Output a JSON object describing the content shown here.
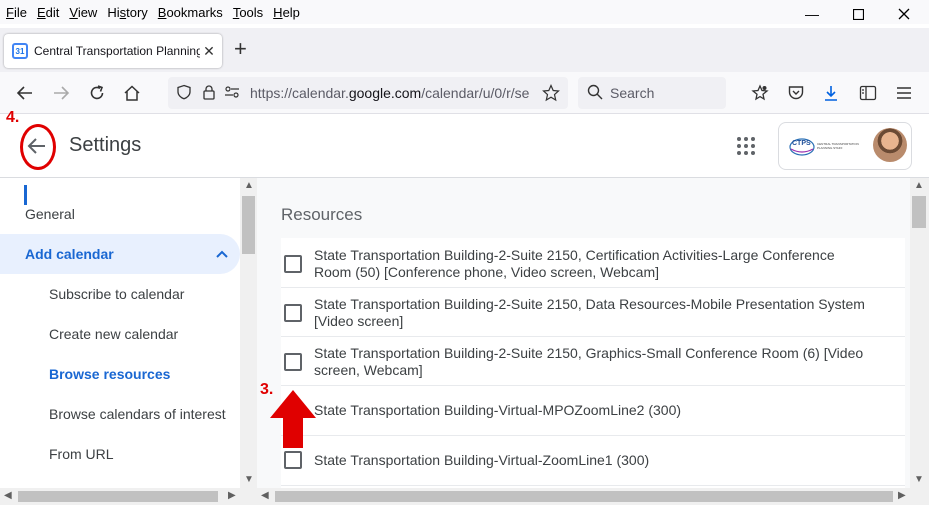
{
  "menubar": {
    "items": [
      "File",
      "Edit",
      "View",
      "History",
      "Bookmarks",
      "Tools",
      "Help"
    ],
    "accel": [
      "F",
      "E",
      "V",
      "s",
      "B",
      "T",
      "H"
    ]
  },
  "tab": {
    "title": "Central Transportation Planning",
    "favicon_text": "31"
  },
  "nav": {
    "url_prefix": "https://calendar.",
    "url_domain": "google.com",
    "url_rest": "/calendar/u/0/r/se",
    "search_placeholder": "Search"
  },
  "header": {
    "title": "Settings",
    "account_logo_text": "CTPS",
    "account_logo_sub": "CENTRAL TRANSPORTATION PLANNING STAFF"
  },
  "sidebar": {
    "items": [
      {
        "label": "General"
      },
      {
        "label": "Add calendar"
      },
      {
        "label": "Subscribe to calendar"
      },
      {
        "label": "Create new calendar"
      },
      {
        "label": "Browse resources"
      },
      {
        "label": "Browse calendars of interest"
      },
      {
        "label": "From URL"
      }
    ]
  },
  "main": {
    "heading": "Resources",
    "resources": [
      {
        "line1": "State Transportation Building-2-Suite 2150, Certification Activities-Large Conference",
        "line2": "Room (50) [Conference phone, Video screen, Webcam]",
        "checked": false
      },
      {
        "line1": "State Transportation Building-2-Suite 2150, Data Resources-Mobile Presentation System",
        "line2": "[Video screen]",
        "checked": false
      },
      {
        "line1": "State Transportation Building-2-Suite 2150, Graphics-Small Conference Room (6) [Video",
        "line2": "screen, Webcam]",
        "checked": false
      },
      {
        "line1": "State Transportation Building-Virtual-MPOZoomLine2 (300)",
        "line2": "",
        "checked": false
      },
      {
        "line1": "State Transportation Building-Virtual-ZoomLine1 (300)",
        "line2": "",
        "checked": false
      }
    ]
  },
  "annotations": {
    "step3": "3.",
    "step4": "4."
  },
  "colors": {
    "accent": "#1967d2",
    "annotation": "#e00000",
    "active_bg": "#e8f0fe"
  }
}
